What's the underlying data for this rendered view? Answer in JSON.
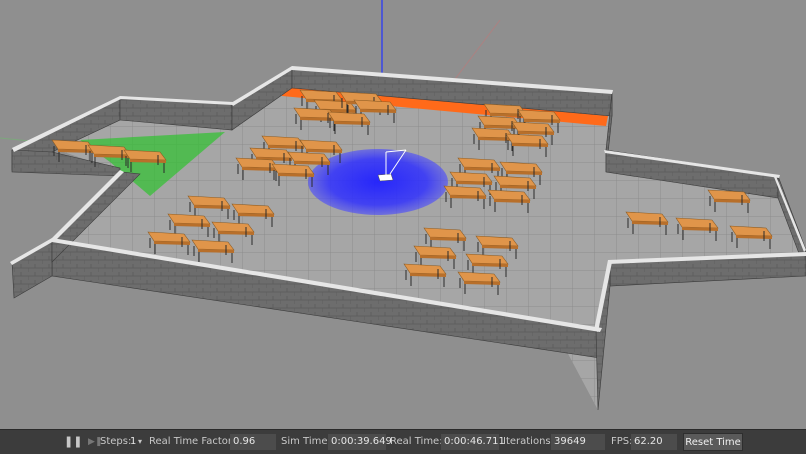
{
  "toolbar": {
    "pause_icon": "pause-icon",
    "step_icon": "step-icon",
    "steps_label": "Steps:",
    "steps_value": "1",
    "real_time_factor_label": "Real Time Factor:",
    "real_time_factor_value": "0.96",
    "sim_time_label": "Sim Time:",
    "sim_time_value": "0:00:39.649",
    "real_time_label": "Real Time:",
    "real_time_value": "0:00:46.711",
    "iterations_label": "Iterations:",
    "iterations_value": "39649",
    "fps_label": "FPS:",
    "fps_value": "62.20",
    "reset_time_label": "Reset Time"
  },
  "scene": {
    "background_color": "#8f8f8f",
    "floor_color": "#a4a4a4",
    "wall_color": "#6e6e6e",
    "wall_top_color": "#e8e8e8",
    "desk_color": "#e0954a",
    "laser_color": "#1a1aff",
    "robot_color": "#ffffff",
    "accent_strip_color": "#ff6a1a",
    "sensor_color": "#2ebd2e"
  }
}
